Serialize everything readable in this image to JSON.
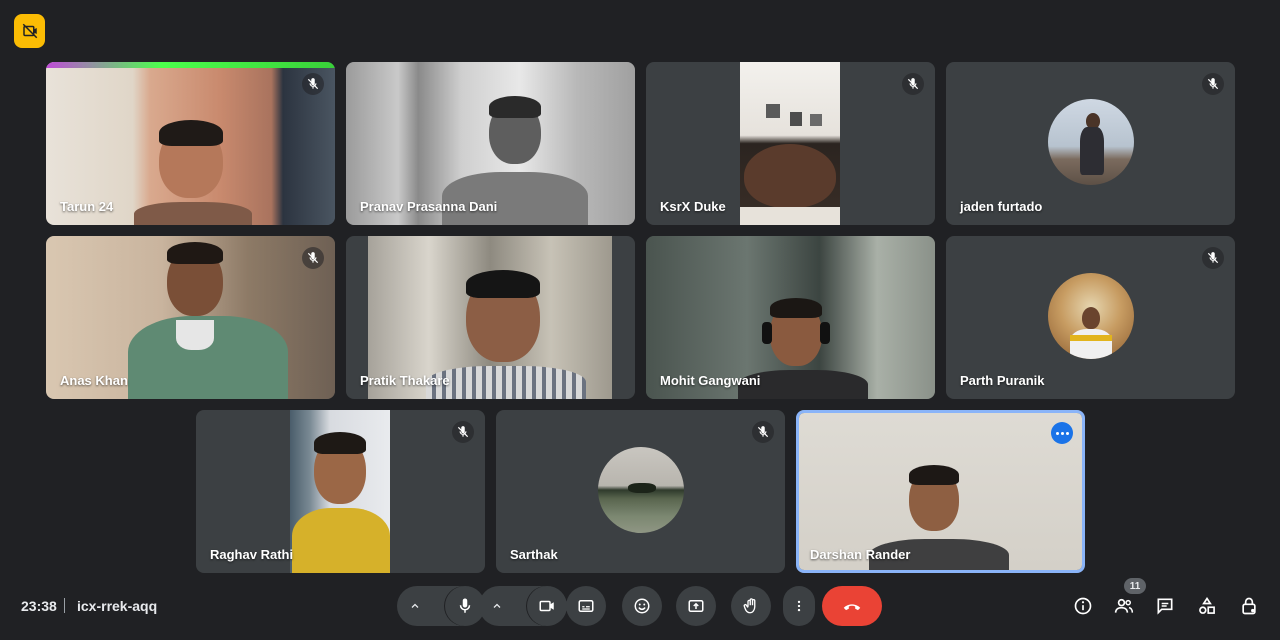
{
  "participants": [
    {
      "name": "Tarun 24",
      "muted": true
    },
    {
      "name": "Pranav Prasanna Dani",
      "muted": false
    },
    {
      "name": "KsrX Duke",
      "muted": true
    },
    {
      "name": "jaden furtado",
      "muted": true
    },
    {
      "name": "Anas Khan",
      "muted": true
    },
    {
      "name": "Pratik Thakare",
      "muted": false
    },
    {
      "name": "Mohit Gangwani",
      "muted": false
    },
    {
      "name": "Parth Puranik",
      "muted": true
    },
    {
      "name": "Raghav Rathi",
      "muted": true
    },
    {
      "name": "Sarthak",
      "muted": true
    },
    {
      "name": "Darshan Rander",
      "muted": false,
      "active_speaker": true
    }
  ],
  "bottom_bar": {
    "time": "23:38",
    "meeting_code": "icx-rrek-aqq",
    "participants_count": "11"
  },
  "icons": {
    "top_badge": "no-camera-presenting-icon",
    "mute": "mic-off-icon",
    "controls": [
      "mic-icon",
      "camera-icon",
      "captions-icon",
      "emoji-icon",
      "present-icon",
      "raise-hand-icon",
      "more-vert-icon",
      "end-call-icon"
    ],
    "right": [
      "info-icon",
      "people-icon",
      "chat-icon",
      "activities-icon",
      "host-controls-icon"
    ]
  },
  "colors": {
    "background": "#202124",
    "tile": "#3c4043",
    "end_call": "#ea4335",
    "active_border": "#8ab4f8",
    "badge_yellow": "#fbbc04"
  }
}
